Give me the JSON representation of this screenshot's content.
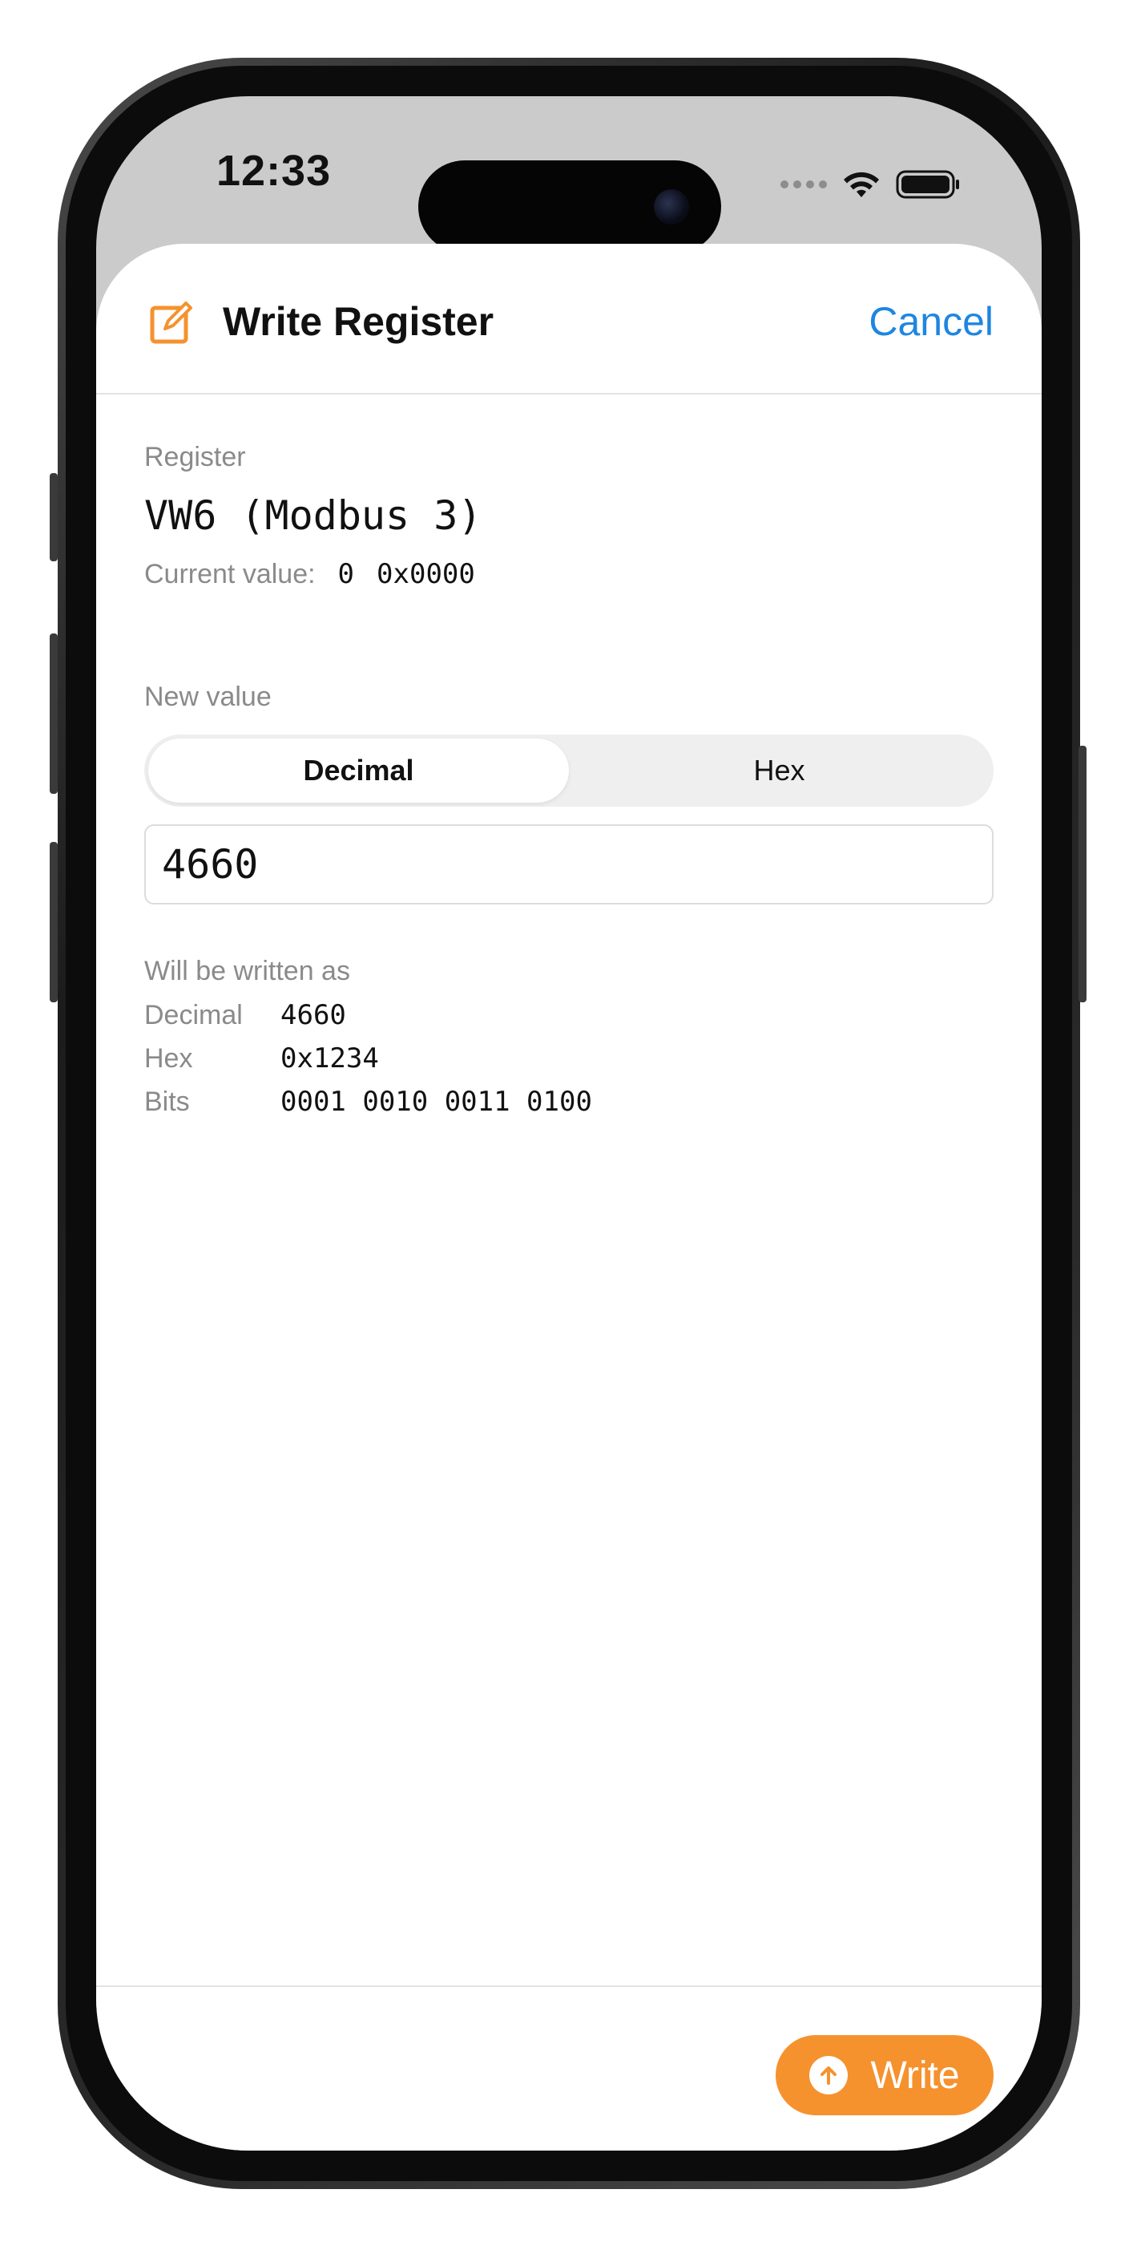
{
  "status_bar": {
    "time": "12:33"
  },
  "sheet": {
    "title": "Write Register",
    "cancel_label": "Cancel",
    "accent_color": "#f5922e",
    "link_color": "#1e86e0"
  },
  "register": {
    "label": "Register",
    "name": "VW6 (Modbus 3)",
    "current_label": "Current value:",
    "current_decimal": "0",
    "current_hex": "0x0000"
  },
  "new_value": {
    "label": "New value",
    "modes": [
      "Decimal",
      "Hex"
    ],
    "selected_mode": "Decimal",
    "input_value": "4660"
  },
  "written_as": {
    "label": "Will be written as",
    "rows": [
      {
        "key": "Decimal",
        "value": "4660"
      },
      {
        "key": "Hex",
        "value": "0x1234"
      },
      {
        "key": "Bits",
        "value": "0001 0010 0011 0100"
      }
    ]
  },
  "footer": {
    "write_label": "Write"
  },
  "icons": {
    "header_icon": "square-and-pencil-icon",
    "write_icon": "arrow-up-circle-icon",
    "wifi": "wifi-icon",
    "battery": "battery-icon"
  }
}
